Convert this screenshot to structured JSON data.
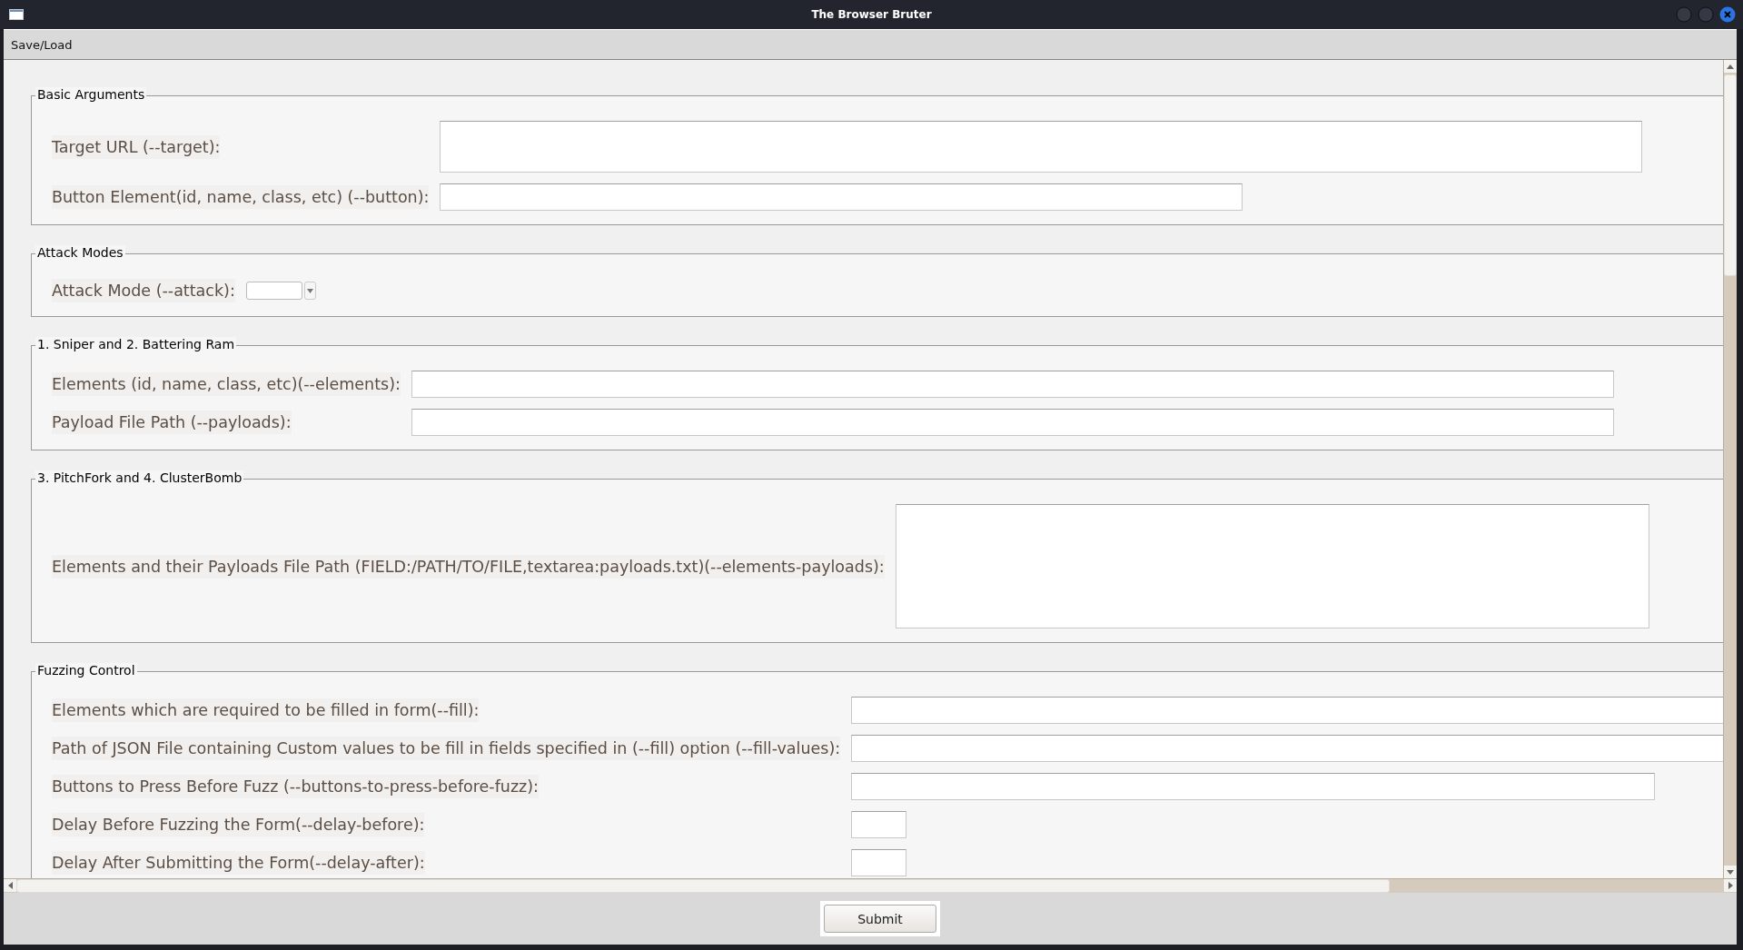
{
  "window": {
    "title": "The Browser Bruter"
  },
  "menu": [
    {
      "label": "Save/Load"
    }
  ],
  "sections": [
    {
      "title": "Basic Arguments",
      "fields": [
        {
          "label": "Target URL (--target):",
          "kind": "tall"
        },
        {
          "label": "Button Element(id, name, class, etc) (--button):",
          "kind": "entry"
        }
      ]
    },
    {
      "title": "Attack Modes",
      "fields": [
        {
          "label": "Attack Mode (--attack):",
          "kind": "combobox"
        }
      ]
    },
    {
      "title": "1. Sniper and 2. Battering Ram",
      "fields": [
        {
          "label": "Elements (id, name, class, etc)(--elements):",
          "kind": "entry"
        },
        {
          "label": "Payload File Path (--payloads):",
          "kind": "entry"
        }
      ]
    },
    {
      "title": "3. PitchFork and 4. ClusterBomb",
      "fields": [
        {
          "label": "Elements and their Payloads File Path (FIELD:/PATH/TO/FILE,textarea:payloads.txt)(--elements-payloads):",
          "kind": "textarea"
        }
      ]
    },
    {
      "title": "Fuzzing Control",
      "fields": [
        {
          "label": "Elements which are required to be filled in form(--fill):",
          "kind": "entry"
        },
        {
          "label": "Path of JSON File containing Custom values to be fill in fields specified in (--fill) option (--fill-values):",
          "kind": "entry"
        },
        {
          "label": "Buttons to Press Before Fuzz (--buttons-to-press-before-fuzz):",
          "kind": "entry"
        },
        {
          "label": "Delay Before Fuzzing the Form(--delay-before):",
          "kind": "short"
        },
        {
          "label": "Delay After Submitting the Form(--delay-after):",
          "kind": "short"
        }
      ]
    }
  ],
  "submit": {
    "label": "Submit"
  }
}
